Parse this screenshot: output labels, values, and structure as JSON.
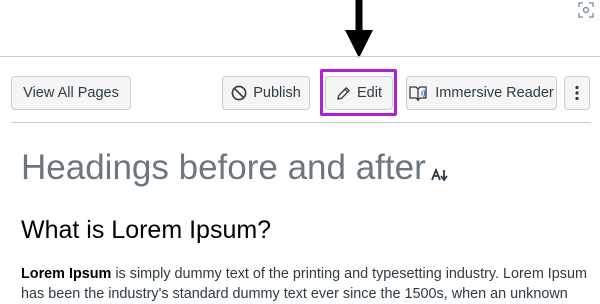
{
  "toolbar": {
    "view_all_label": "View All Pages",
    "publish_label": "Publish",
    "edit_label": "Edit",
    "immersive_reader_label": "Immersive Reader"
  },
  "page": {
    "title": "Headings before and after",
    "heading": "What is Lorem Ipsum?",
    "bold_lead": "Lorem Ipsum",
    "paragraph_rest": " is simply dummy text of the printing and typesetting industry. Lorem Ipsum has been the industry's standard dummy text ever since the 1500s, when an unknown"
  },
  "colors": {
    "highlight": "#b01ed8",
    "button_bg": "#f5f5f5",
    "title_gray": "#6b7780"
  },
  "icons": {
    "publish": "no-entry-icon",
    "edit": "pencil-icon",
    "reader": "immersive-reader-icon",
    "more": "vertical-dots-icon",
    "arrow": "down-arrow-icon",
    "corner": "focus-scan-icon",
    "sort": "sort-icon"
  }
}
